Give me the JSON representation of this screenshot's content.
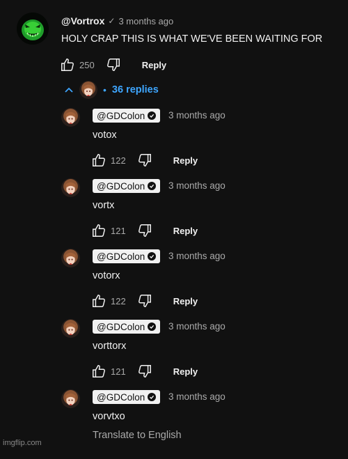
{
  "comment": {
    "handle": "@Vortrox",
    "time": "3 months ago",
    "text": "HOLY CRAP THIS IS WHAT WE'VE BEEN WAITING FOR",
    "likes": "250",
    "reply_label": "Reply",
    "avatar_icon": "green-grin-face-icon"
  },
  "replies_toggle": {
    "label": "36 replies",
    "dot": "•"
  },
  "replies": [
    {
      "handle": "@GDColon",
      "time": "3 months ago",
      "text": "votox",
      "likes": "122",
      "reply_label": "Reply"
    },
    {
      "handle": "@GDColon",
      "time": "3 months ago",
      "text": "vortx",
      "likes": "121",
      "reply_label": "Reply"
    },
    {
      "handle": "@GDColon",
      "time": "3 months ago",
      "text": "votorx",
      "likes": "122",
      "reply_label": "Reply"
    },
    {
      "handle": "@GDColon",
      "time": "3 months ago",
      "text": "vorttorx",
      "likes": "121",
      "reply_label": "Reply"
    },
    {
      "handle": "@GDColon",
      "time": "3 months ago",
      "text": "vorvtxo"
    }
  ],
  "translate_label": "Translate to English",
  "watermark": "imgflip.com",
  "colors": {
    "background": "#111111",
    "link": "#3ea6ff",
    "muted": "#aaaaaa",
    "text": "#f1f1f1"
  }
}
